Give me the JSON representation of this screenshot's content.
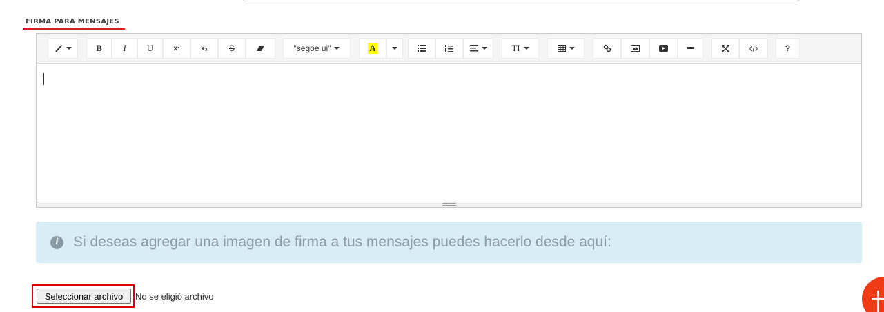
{
  "section": {
    "label": "FIRMA PARA MENSAJES"
  },
  "toolbar": {
    "bold": "B",
    "italic": "I",
    "underline": "U",
    "superscript": "x²",
    "subscript": "x₂",
    "strike": "S",
    "font_name": "\"segoe ui\"",
    "color_letter": "A",
    "font_size": "TI",
    "help": "?"
  },
  "info": {
    "text": "Si deseas agregar una imagen de firma a tus mensajes puedes hacerlo desde aquí:"
  },
  "file": {
    "button_label": "Seleccionar archivo",
    "status": "No se eligió archivo"
  },
  "colors": {
    "accent": "#d71920",
    "info_bg": "#d9edf7",
    "fab": "#f03c16"
  }
}
